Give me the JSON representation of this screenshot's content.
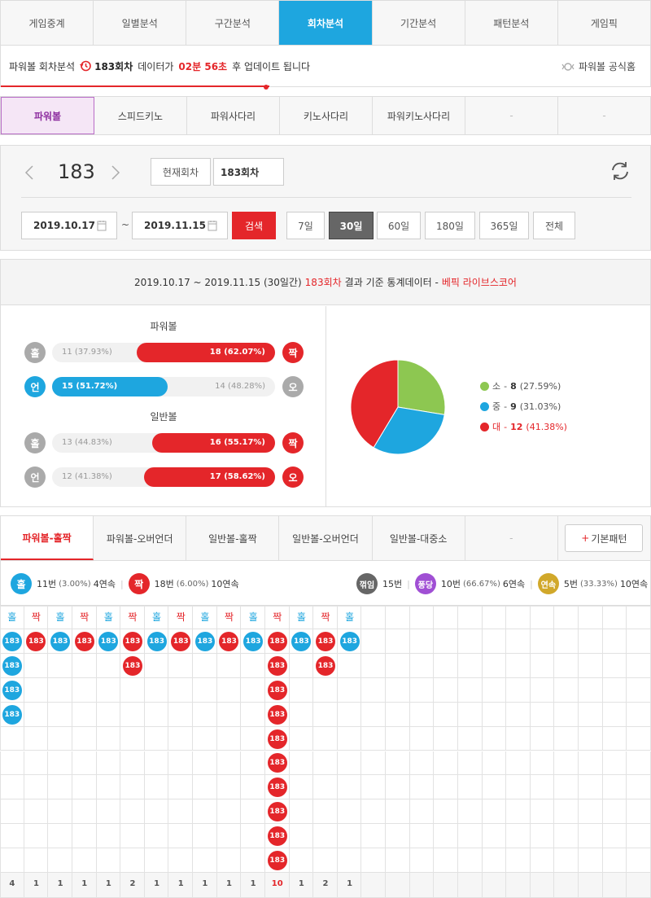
{
  "top_nav": [
    "게임중계",
    "일별분석",
    "구간분석",
    "회차분석",
    "기간분석",
    "패턴분석",
    "게임픽"
  ],
  "top_nav_active": 3,
  "info": {
    "prefix": "파워볼 회차분석",
    "round": "183회차",
    "mid": "데이터가",
    "countdown": "02분 56초",
    "suffix": "후 업데이트 됩니다",
    "home_link": "파워볼 공식홈"
  },
  "sub_tabs": [
    "파워볼",
    "스피드키노",
    "파워사다리",
    "키노사다리",
    "파워키노사다리",
    "-",
    "-"
  ],
  "sub_tabs_active": 0,
  "round_panel": {
    "round": "183",
    "current_btn": "현재회차",
    "round_input": "183회차",
    "date_from": "2019.10.17",
    "tilde": "~",
    "date_to": "2019.11.15",
    "search": "검색",
    "periods": [
      "7일",
      "30일",
      "60일",
      "180일",
      "365일",
      "전체"
    ],
    "period_active": 1
  },
  "stats": {
    "header_main": "2019.10.17 ~ 2019.11.15 (30일간)",
    "header_round": "183회차",
    "header_mid": "결과 기준 통계데이터 -",
    "header_source": "베픽 라이브스코어",
    "powerball_title": "파워볼",
    "normal_title": "일반볼",
    "rows": [
      {
        "left": "홀",
        "left_label": "11 (37.93%)",
        "right_label": "18 (62.07%)",
        "right": "짝",
        "fill": 0.6207,
        "side": "right",
        "left_color": "gray",
        "right_color": "red"
      },
      {
        "left": "언",
        "left_label": "15 (51.72%)",
        "right_label": "14 (48.28%)",
        "right": "오",
        "fill": 0.5172,
        "side": "left",
        "left_color": "blue",
        "right_color": "gray"
      },
      {
        "left": "홀",
        "left_label": "13 (44.83%)",
        "right_label": "16 (55.17%)",
        "right": "짝",
        "fill": 0.5517,
        "side": "right",
        "left_color": "gray",
        "right_color": "red"
      },
      {
        "left": "언",
        "left_label": "12 (41.38%)",
        "right_label": "17 (58.62%)",
        "right": "오",
        "fill": 0.5862,
        "side": "right",
        "left_color": "gray",
        "right_color": "red"
      }
    ],
    "pie": [
      {
        "label": "소",
        "count": "8",
        "pct": "(27.59%)",
        "value": 27.59,
        "color": "#8dc751"
      },
      {
        "label": "중",
        "count": "9",
        "pct": "(31.03%)",
        "value": 31.03,
        "color": "#1ea6df"
      },
      {
        "label": "대",
        "count": "12",
        "pct": "(41.38%)",
        "value": 41.38,
        "color": "#e4262a"
      }
    ],
    "legend_sep": "-"
  },
  "pattern_tabs": [
    "파워볼-홀짝",
    "파워볼-오버언더",
    "일반볼-홀짝",
    "일반볼-오버언더",
    "일반볼-대중소",
    "-"
  ],
  "pattern_tabs_active": 0,
  "basic_pattern_plus": "+",
  "basic_pattern_label": "기본패턴",
  "summary": {
    "odd_badge": "홀",
    "odd_count": "11번",
    "odd_pct": "(3.00%)",
    "odd_streak": "4연속",
    "even_badge": "짝",
    "even_count": "18번",
    "even_pct": "(6.00%)",
    "even_streak": "10연속",
    "break_badge": "꺾임",
    "break_count": "15번",
    "pong_badge": "퐁당",
    "pong_count": "10번",
    "pong_pct": "(66.67%)",
    "pong_streak": "6연속",
    "cont_badge": "연속",
    "cont_count": "5번",
    "cont_pct": "(33.33%)",
    "cont_streak": "10연속"
  },
  "pattern_grid": {
    "columns": [
      {
        "head": "홀",
        "count": 4
      },
      {
        "head": "짝",
        "count": 1
      },
      {
        "head": "홀",
        "count": 1
      },
      {
        "head": "짝",
        "count": 1
      },
      {
        "head": "홀",
        "count": 1
      },
      {
        "head": "짝",
        "count": 2
      },
      {
        "head": "홀",
        "count": 1
      },
      {
        "head": "짝",
        "count": 1
      },
      {
        "head": "홀",
        "count": 1
      },
      {
        "head": "짝",
        "count": 1
      },
      {
        "head": "홀",
        "count": 1
      },
      {
        "head": "짝",
        "count": 10
      },
      {
        "head": "홀",
        "count": 1
      },
      {
        "head": "짝",
        "count": 2
      },
      {
        "head": "홀",
        "count": 1
      }
    ],
    "ball_label": "183",
    "count_labels": [
      "4",
      "1",
      "1",
      "1",
      "1",
      "2",
      "1",
      "1",
      "1",
      "1",
      "1",
      "10",
      "1",
      "2",
      "1"
    ]
  }
}
